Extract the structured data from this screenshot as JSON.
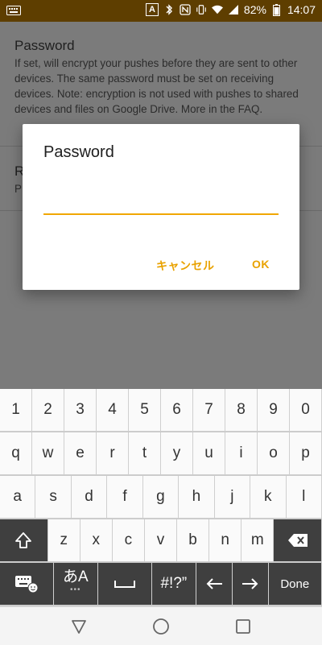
{
  "status_bar": {
    "ime_icon": "keyboard-icon",
    "ime_indicator": "A",
    "battery": "82%",
    "time": "14:07"
  },
  "background": {
    "pref1": {
      "title": "Password",
      "summary": "If set, will encrypt your pushes before they are sent to other devices. The same password must be set on receiving devices. Note: encryption is not used with pushes to shared devices and files on Google Drive. More in the FAQ."
    },
    "pref2": {
      "title_initial": "R",
      "summary_initial": "P"
    }
  },
  "dialog": {
    "title": "Password",
    "input_value": "",
    "cancel_label": "キャンセル",
    "ok_label": "OK",
    "accent_color": "#e9a200"
  },
  "keyboard": {
    "row1": [
      "1",
      "2",
      "3",
      "4",
      "5",
      "6",
      "7",
      "8",
      "9",
      "0"
    ],
    "row2": [
      "q",
      "w",
      "e",
      "r",
      "t",
      "y",
      "u",
      "i",
      "o",
      "p"
    ],
    "row3": [
      "a",
      "s",
      "d",
      "f",
      "g",
      "h",
      "j",
      "k",
      "l"
    ],
    "row4": [
      "z",
      "x",
      "c",
      "v",
      "b",
      "n",
      "m"
    ],
    "lang_label": "あA",
    "lang_dots": "•••",
    "symbols_label": "#!?”",
    "done_label": "Done"
  },
  "navbar": {
    "icons": [
      "back-icon",
      "home-icon",
      "recents-icon"
    ]
  }
}
